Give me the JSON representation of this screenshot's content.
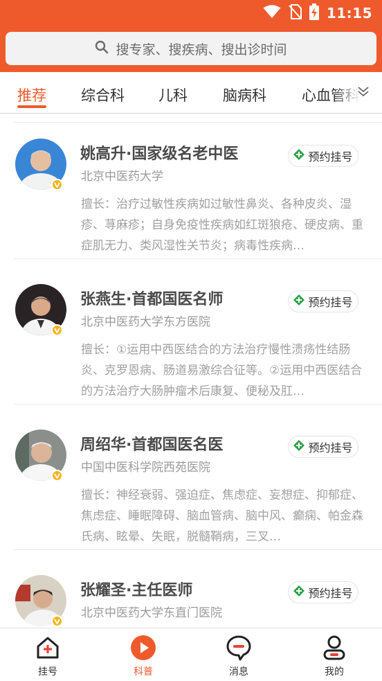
{
  "status_bar": {
    "time": "11:15"
  },
  "search": {
    "placeholder": "搜专家、搜疾病、搜出诊时间"
  },
  "tabs": [
    {
      "label": "推荐",
      "active": true
    },
    {
      "label": "综合科",
      "active": false
    },
    {
      "label": "儿科",
      "active": false
    },
    {
      "label": "脑病科",
      "active": false
    },
    {
      "label": "心血管科",
      "active": false
    }
  ],
  "doctors": [
    {
      "name": "姚高升·国家级名老中医",
      "hospital": "北京中医药大学",
      "book_label": "预约挂号",
      "specialty": "擅长：治疗过敏性疾病如过敏性鼻炎、各种皮炎、湿疹、荨麻疹；自身免疫性疾病如红斑狼疮、硬皮病、重症肌无力、类风湿性关节炎；病毒性疾病…"
    },
    {
      "name": "张燕生·首都国医名师",
      "hospital": "北京中医药大学东方医院",
      "book_label": "预约挂号",
      "specialty": "擅长：①运用中西医结合的方法治疗慢性溃疡性结肠炎、克罗恩病、肠道易激综合征等。②运用中西医结合的方法治疗大肠肿瘤术后康复、便秘及肛…"
    },
    {
      "name": "周绍华·首都国医名医",
      "hospital": "中国中医科学院西苑医院",
      "book_label": "预约挂号",
      "specialty": "擅长：神经衰弱、强迫症、焦虑症、妄想症、抑郁症、焦虑症、睡眠障碍、脑血管病、脑中风、癫痫、帕金森氏病、眩晕、失眠，脱髓鞘病，三叉…"
    },
    {
      "name": "张耀圣·主任医师",
      "hospital": "北京中医药大学东直门医院",
      "book_label": "预约挂号",
      "specialty": ""
    }
  ],
  "bottom_nav": [
    {
      "label": "挂号",
      "icon": "hospital-icon",
      "active": false
    },
    {
      "label": "科普",
      "icon": "play-icon",
      "active": true
    },
    {
      "label": "消息",
      "icon": "message-icon",
      "active": false
    },
    {
      "label": "我的",
      "icon": "profile-icon",
      "active": false
    }
  ],
  "colors": {
    "brand": "#ef5a2d",
    "book_icon": "#2da24a",
    "badge": "#f6b51f"
  }
}
